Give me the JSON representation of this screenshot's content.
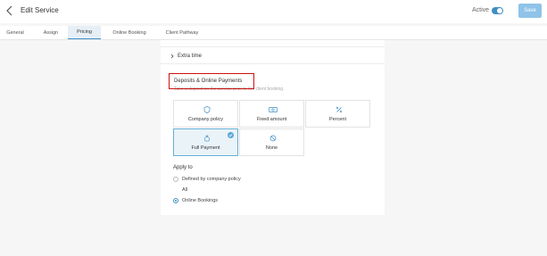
{
  "header": {
    "title": "Edit Service",
    "active_label": "Active",
    "save_label": "Save"
  },
  "tabs": [
    {
      "label": "General"
    },
    {
      "label": "Assign"
    },
    {
      "label": "Pricing"
    },
    {
      "label": "Online Booking"
    },
    {
      "label": "Client Pathway"
    }
  ],
  "active_tab": "Pricing",
  "extra_time": {
    "label": "Extra time"
  },
  "deposits": {
    "title": "Deposits & Online Payments",
    "subtitle": "Take a deposit on the service prior to the client booking.",
    "options": [
      {
        "label": "Company policy",
        "icon": "shield-icon"
      },
      {
        "label": "Fixed amount",
        "icon": "cash-icon"
      },
      {
        "label": "Percent",
        "icon": "percent-icon"
      },
      {
        "label": "Full Payment",
        "icon": "money-bag-icon"
      },
      {
        "label": "None",
        "icon": "no-entry-icon"
      }
    ],
    "selected": "Full Payment"
  },
  "apply_to": {
    "label": "Apply to",
    "options": [
      {
        "label": "Defined by company policy"
      },
      {
        "label": "All"
      },
      {
        "label": "Online Bookings"
      }
    ],
    "selected": "Online Bookings"
  },
  "colors": {
    "accent": "#3f8fc4",
    "save_button": "#8fc3e8",
    "highlight_box": "#d01010"
  }
}
